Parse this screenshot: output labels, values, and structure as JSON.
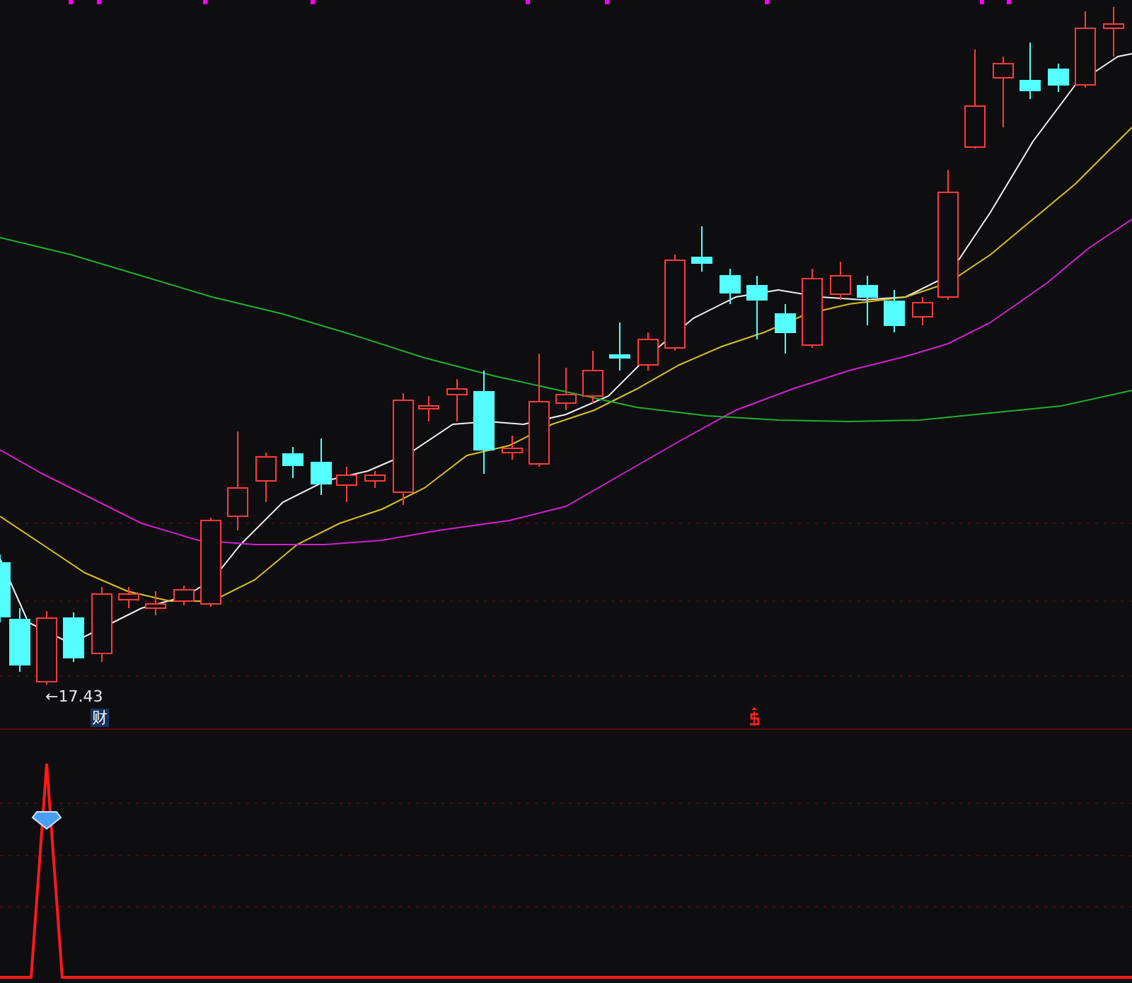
{
  "main_chart": {
    "low_label": "←17.43",
    "news_tag": "财"
  }
}
